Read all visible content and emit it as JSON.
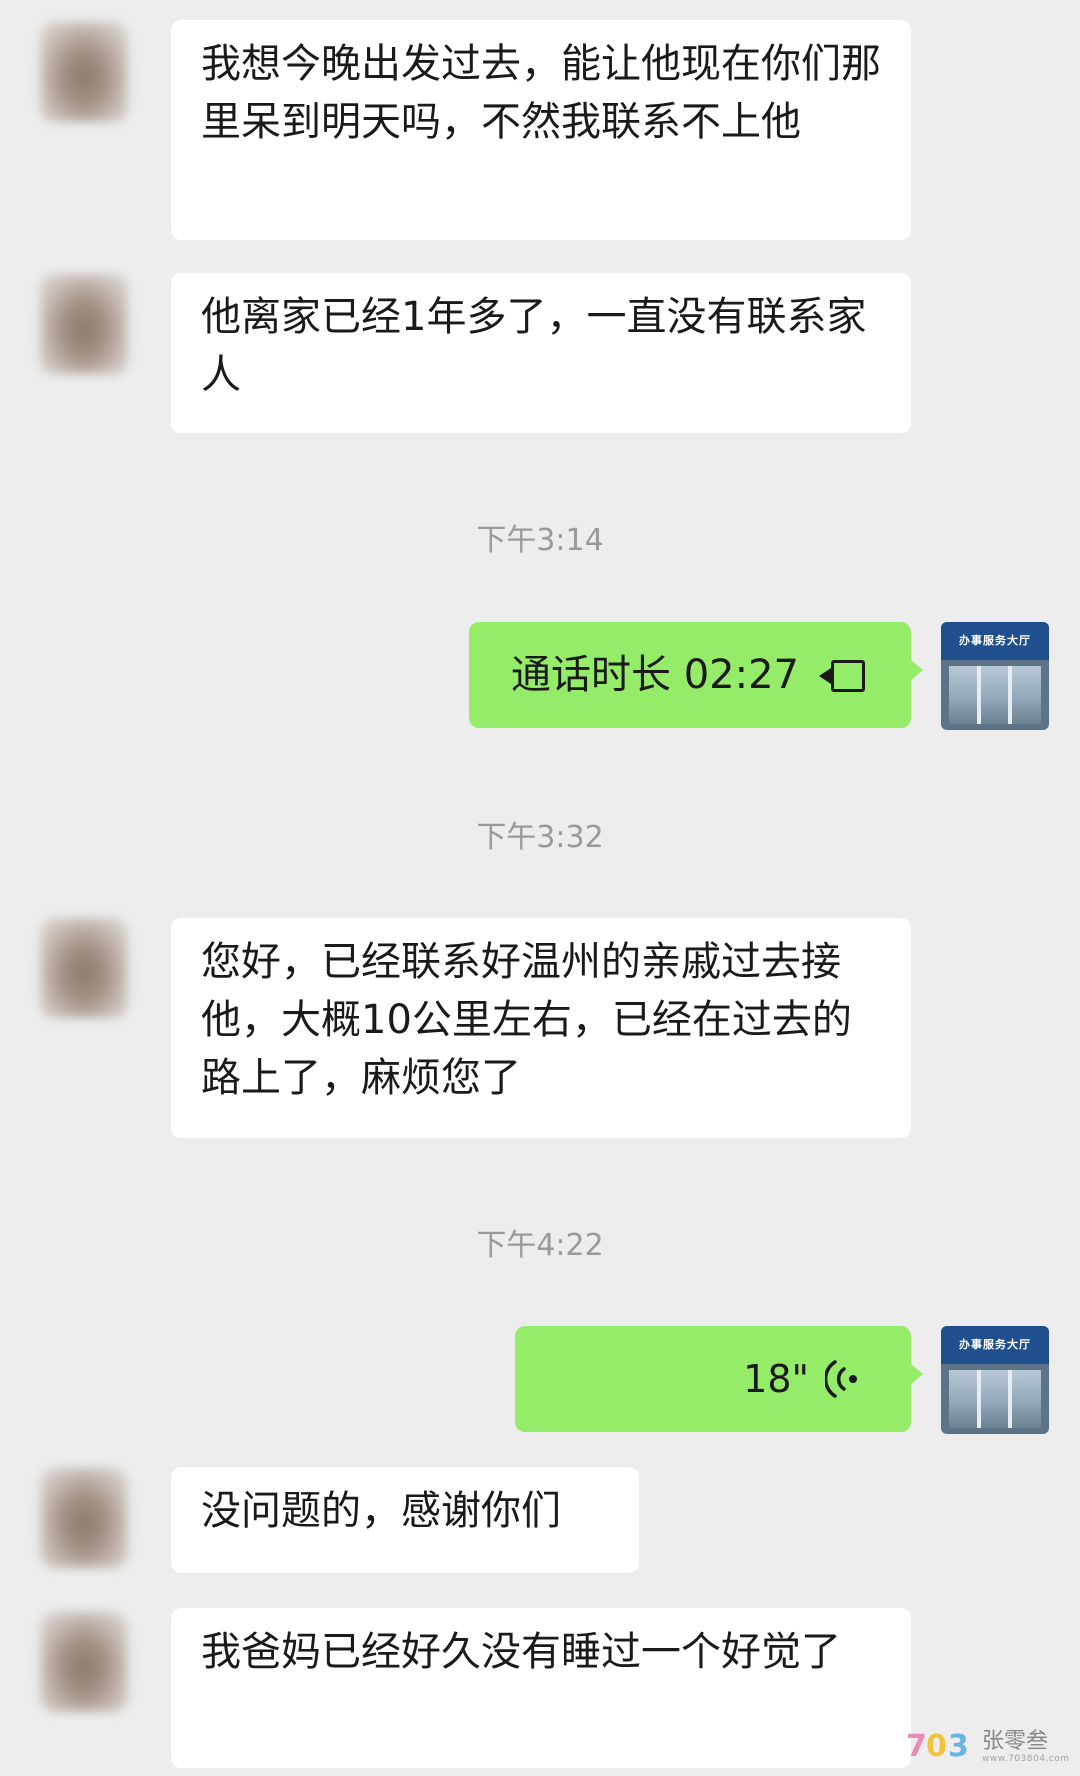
{
  "messages": {
    "m1": {
      "text": "我想今晚出发过去，能让他现在你们那里呆到明天吗，不然我联系不上他"
    },
    "m2": {
      "text": "他离家已经1年多了，一直没有联系家人"
    },
    "t1": "下午3:14",
    "call": {
      "label": "通话时长 02:27",
      "icon": "video-call-icon"
    },
    "t2": "下午3:32",
    "m3": {
      "text": "您好，已经联系好温州的亲戚过去接他，大概10公里左右，已经在过去的路上了，麻烦您了"
    },
    "t3": "下午4:22",
    "voice": {
      "duration": "18\"",
      "icon": "voice-wave-icon"
    },
    "m4": {
      "text": "没问题的，感谢你们"
    },
    "m5": {
      "text": "我爸妈已经好久没有睡过一个好觉了"
    }
  },
  "self_avatar": {
    "sign_text": "办事服务大厅"
  },
  "watermark": {
    "name": "张零叁",
    "url": "www.703804.com",
    "logo_chars": "703"
  },
  "colors": {
    "background": "#ededed",
    "incoming_bubble": "#ffffff",
    "outgoing_bubble": "#95ec69",
    "timestamp": "#9a9a9a",
    "text": "#1a1a1a"
  }
}
